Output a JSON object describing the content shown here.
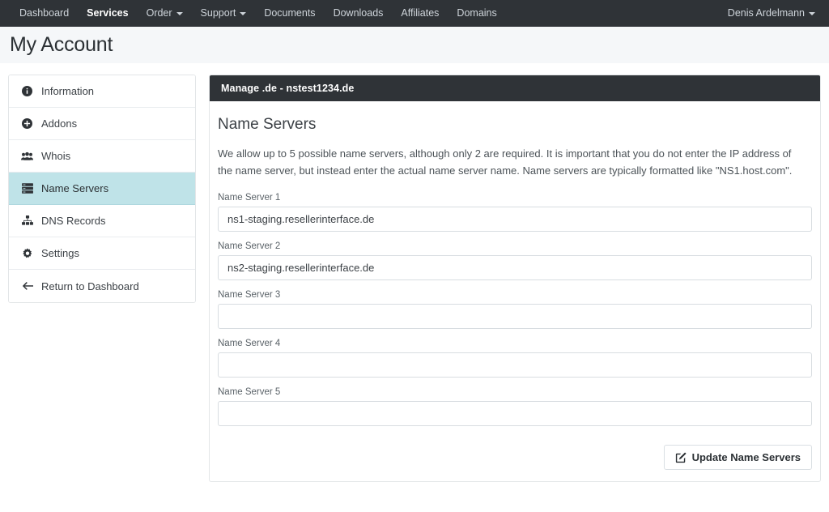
{
  "navbar": {
    "items": [
      {
        "label": "Dashboard",
        "icon": "",
        "active": false,
        "caret": false
      },
      {
        "label": "Services",
        "icon": "",
        "active": true,
        "caret": false
      },
      {
        "label": "Order",
        "icon": "chevron-down-icon",
        "active": false,
        "caret": true
      },
      {
        "label": "Support",
        "icon": "chevron-down-icon",
        "active": false,
        "caret": true
      },
      {
        "label": "Documents",
        "icon": "",
        "active": false,
        "caret": false
      },
      {
        "label": "Downloads",
        "icon": "",
        "active": false,
        "caret": false
      },
      {
        "label": "Affiliates",
        "icon": "",
        "active": false,
        "caret": false
      },
      {
        "label": "Domains",
        "icon": "",
        "active": false,
        "caret": false
      }
    ],
    "user": "Denis Ardelmann",
    "background_color": "#2f3337"
  },
  "page": {
    "title": "My Account",
    "header_background": "#f5f7f9"
  },
  "sidebar": {
    "items": [
      {
        "label": "Information",
        "icon": "info-circle-icon",
        "active": false
      },
      {
        "label": "Addons",
        "icon": "plus-circle-icon",
        "active": false
      },
      {
        "label": "Whois",
        "icon": "users-icon",
        "active": false
      },
      {
        "label": "Name Servers",
        "icon": "server-icon",
        "active": true
      },
      {
        "label": "DNS Records",
        "icon": "sitemap-icon",
        "active": false
      },
      {
        "label": "Settings",
        "icon": "gear-icon",
        "active": false
      },
      {
        "label": "Return to Dashboard",
        "icon": "arrow-left-icon",
        "active": false
      }
    ],
    "active_background": "#bfe3e8"
  },
  "panel": {
    "header": "Manage .de - nstest1234.de",
    "heading": "Name Servers",
    "description": "We allow up to 5 possible name servers, although only 2 are required. It is important that you do not enter the IP address of the name server, but instead enter the actual name server name. Name servers are typically formatted like \"NS1.host.com\".",
    "fields": [
      {
        "label": "Name Server 1",
        "value": "ns1-staging.resellerinterface.de",
        "placeholder": ""
      },
      {
        "label": "Name Server 2",
        "value": "ns2-staging.resellerinterface.de",
        "placeholder": ""
      },
      {
        "label": "Name Server 3",
        "value": "",
        "placeholder": ""
      },
      {
        "label": "Name Server 4",
        "value": "",
        "placeholder": ""
      },
      {
        "label": "Name Server 5",
        "value": "",
        "placeholder": ""
      }
    ],
    "update_button": {
      "label": "Update Name Servers",
      "icon": "pencil-square-icon"
    }
  }
}
